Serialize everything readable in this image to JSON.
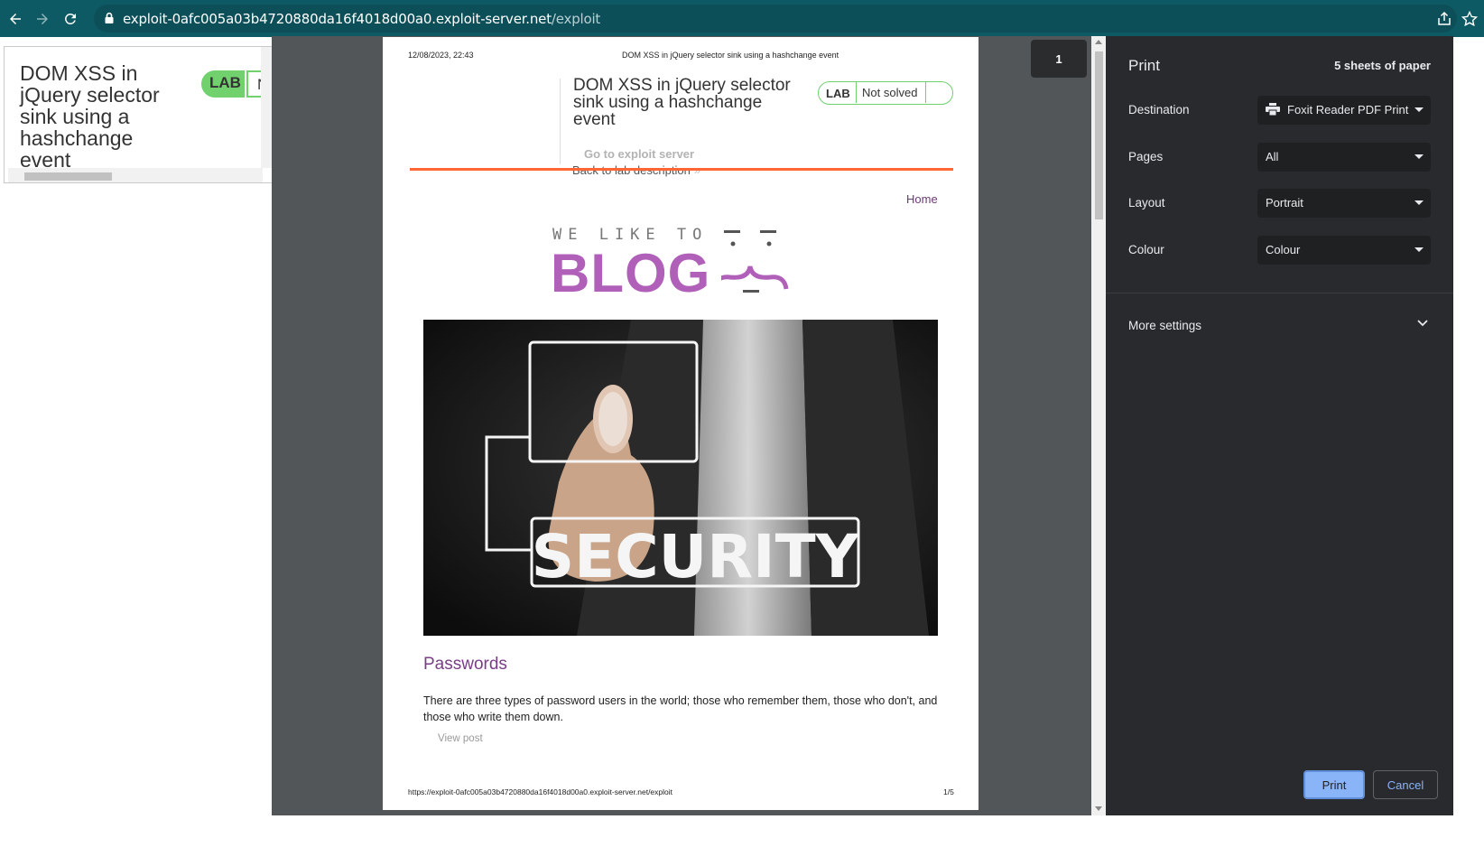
{
  "browser": {
    "url_host": "exploit-0afc005a03b4720880da16f4018d00a0.exploit-server.net",
    "url_path": "/exploit"
  },
  "background_page": {
    "title": "DOM XSS in jQuery selector sink using a hashchange event",
    "lab_label": "LAB",
    "status_fragment": "N"
  },
  "preview": {
    "header_date": "12/08/2023, 22:43",
    "header_title": "DOM XSS in jQuery selector sink using a hashchange event",
    "page_title": "DOM XSS in jQuery selector sink using a hashchange event",
    "lab_label": "LAB",
    "lab_status": "Not solved",
    "exploit_link": "Go to exploit server",
    "back_link": "Back to lab description",
    "back_chevrons": "»",
    "home_link": "Home",
    "blog_tagline": "WE LIKE TO",
    "blog_word": "BLOG",
    "hero_text": "SECURITY",
    "post_title": "Passwords",
    "post_text": "There are three types of password users in the world; those who remember them, those who don't, and those who write them down.",
    "view_post": "View post",
    "footer_url": "https://exploit-0afc005a03b4720880da16f4018d00a0.exploit-server.net/exploit",
    "footer_page": "1/5",
    "page_indicator": "1"
  },
  "print_panel": {
    "title": "Print",
    "sheets": "5 sheets of paper",
    "destination_label": "Destination",
    "destination_value": "Foxit Reader PDF Print",
    "pages_label": "Pages",
    "pages_value": "All",
    "layout_label": "Layout",
    "layout_value": "Portrait",
    "colour_label": "Colour",
    "colour_value": "Colour",
    "more_settings": "More settings",
    "print_button": "Print",
    "cancel_button": "Cancel"
  },
  "colors": {
    "toolbar": "#0e5a64",
    "lab_green": "#70d16d",
    "accent_orange": "#ff6633",
    "blog_purple": "#b060b8",
    "panel_bg": "#292a2d",
    "print_button": "#8ab4f8"
  }
}
